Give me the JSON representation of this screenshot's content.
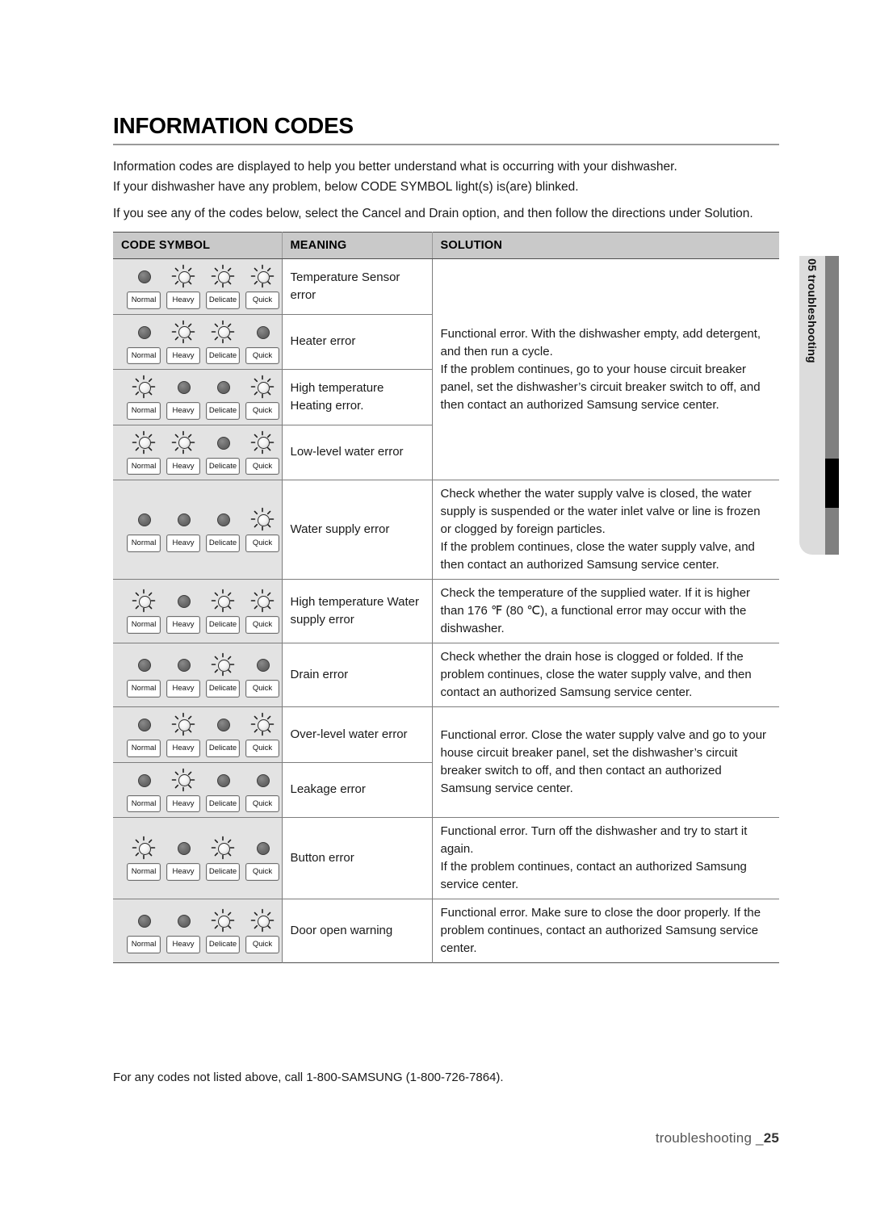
{
  "page": {
    "title": "INFORMATION CODES",
    "intro": [
      "Information codes are displayed to help you better understand what is occurring with your dishwasher.",
      "If your dishwasher have any problem, below CODE SYMBOL light(s) is(are) blinked.",
      "If you see any of the codes below, select the Cancel and Drain option, and then follow the directions under Solution."
    ],
    "footnote": "For any codes not listed above, call 1-800-SAMSUNG (1-800-726-7864).",
    "footer_label": "troubleshooting _",
    "footer_page": "25"
  },
  "side_tab": {
    "label": "05 troubleshooting",
    "panel_color": "#dcdcdc",
    "bar_color": "#808080",
    "marker_color": "#000000"
  },
  "table": {
    "headers": [
      "CODE SYMBOL",
      "MEANING",
      "SOLUTION"
    ],
    "button_labels": [
      "Normal",
      "Heavy",
      "Delicate",
      "Quick"
    ],
    "header_bg": "#c9c9c9",
    "symbol_cell_bg": "#e3e3e3",
    "rows": [
      {
        "leds": [
          "off",
          "on",
          "on",
          "on"
        ],
        "meaning": "Temperature Sensor error",
        "solution": "Functional error. With the dishwasher empty, add detergent, and then run a cycle.\nIf the problem continues, go to your house circuit breaker panel, set the dishwasher’s circuit breaker switch to off, and then contact an authorized Samsung service center.",
        "solution_rowspan": 4
      },
      {
        "leds": [
          "off",
          "on",
          "on",
          "off"
        ],
        "meaning": "Heater error",
        "solution": null
      },
      {
        "leds": [
          "on",
          "off",
          "off",
          "on"
        ],
        "meaning": "High temperature Heating error.",
        "solution": null
      },
      {
        "leds": [
          "on",
          "on",
          "off",
          "on"
        ],
        "meaning": "Low-level water error",
        "solution": null
      },
      {
        "leds": [
          "off",
          "off",
          "off",
          "on"
        ],
        "meaning": "Water supply error",
        "solution": "Check whether the water supply valve is closed, the water supply is suspended or the water inlet valve or line is frozen or clogged by foreign particles.\nIf the problem continues, close the water supply valve, and then contact an authorized Samsung service center.",
        "solution_rowspan": 1
      },
      {
        "leds": [
          "on",
          "off",
          "on",
          "on"
        ],
        "meaning": "High temperature Water supply error",
        "solution": "Check the temperature of the supplied water. If it is higher than 176 ℉ (80 ℃), a functional error may occur with the dishwasher.",
        "solution_rowspan": 1
      },
      {
        "leds": [
          "off",
          "off",
          "on",
          "off"
        ],
        "meaning": "Drain error",
        "solution": "Check whether the drain hose is clogged or folded. If the problem continues, close the water supply valve, and then contact an authorized Samsung service center.",
        "solution_rowspan": 1
      },
      {
        "leds": [
          "off",
          "on",
          "off",
          "on"
        ],
        "meaning": "Over-level water error",
        "solution": "Functional error. Close the water supply valve and go to your house circuit breaker panel, set the dishwasher’s circuit breaker switch to off, and then contact an authorized Samsung service center.",
        "solution_rowspan": 2
      },
      {
        "leds": [
          "off",
          "on",
          "off",
          "off"
        ],
        "meaning": "Leakage error",
        "solution": null
      },
      {
        "leds": [
          "on",
          "off",
          "on",
          "off"
        ],
        "meaning": "Button error",
        "solution": "Functional error. Turn off the dishwasher and try to start it again.\nIf the problem continues, contact an authorized Samsung service center.",
        "solution_rowspan": 1
      },
      {
        "leds": [
          "off",
          "off",
          "on",
          "on"
        ],
        "meaning": "Door open warning",
        "solution": "Functional error. Make sure to close the door properly. If the problem continues, contact an authorized Samsung service center.",
        "solution_rowspan": 1
      }
    ]
  }
}
